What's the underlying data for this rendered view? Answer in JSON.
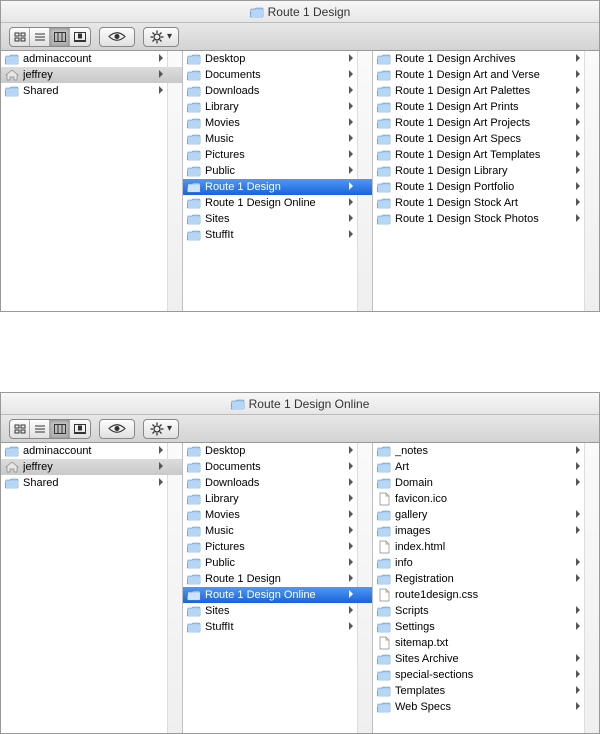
{
  "windows": [
    {
      "title": "Route 1 Design",
      "columns": [
        {
          "items": [
            {
              "label": "adminaccount",
              "icon": "folder",
              "arrow": true
            },
            {
              "label": "jeffrey",
              "icon": "home",
              "arrow": true,
              "state": "grey"
            },
            {
              "label": "Shared",
              "icon": "folder",
              "arrow": true
            }
          ]
        },
        {
          "items": [
            {
              "label": "Desktop",
              "icon": "folder",
              "arrow": true
            },
            {
              "label": "Documents",
              "icon": "folder",
              "arrow": true
            },
            {
              "label": "Downloads",
              "icon": "folder",
              "arrow": true
            },
            {
              "label": "Library",
              "icon": "folder",
              "arrow": true
            },
            {
              "label": "Movies",
              "icon": "folder",
              "arrow": true
            },
            {
              "label": "Music",
              "icon": "folder",
              "arrow": true
            },
            {
              "label": "Pictures",
              "icon": "folder",
              "arrow": true
            },
            {
              "label": "Public",
              "icon": "folder",
              "arrow": true
            },
            {
              "label": "Route 1 Design",
              "icon": "folder",
              "arrow": true,
              "state": "blue"
            },
            {
              "label": "Route 1 Design Online",
              "icon": "folder",
              "arrow": true
            },
            {
              "label": "Sites",
              "icon": "folder",
              "arrow": true
            },
            {
              "label": "StuffIt",
              "icon": "folder",
              "arrow": true
            }
          ]
        },
        {
          "items": [
            {
              "label": "Route 1 Design Archives",
              "icon": "folder",
              "arrow": true
            },
            {
              "label": "Route 1 Design Art and Verse",
              "icon": "folder",
              "arrow": true
            },
            {
              "label": "Route 1 Design Art Palettes",
              "icon": "folder",
              "arrow": true
            },
            {
              "label": "Route 1 Design Art Prints",
              "icon": "folder",
              "arrow": true
            },
            {
              "label": "Route 1 Design Art Projects",
              "icon": "folder",
              "arrow": true
            },
            {
              "label": "Route 1 Design Art Specs",
              "icon": "folder",
              "arrow": true
            },
            {
              "label": "Route 1 Design Art Templates",
              "icon": "folder",
              "arrow": true
            },
            {
              "label": "Route 1 Design Library",
              "icon": "folder",
              "arrow": true
            },
            {
              "label": "Route 1 Design Portfolio",
              "icon": "folder",
              "arrow": true
            },
            {
              "label": "Route 1 Design Stock Art",
              "icon": "folder",
              "arrow": true
            },
            {
              "label": "Route 1 Design Stock Photos",
              "icon": "folder",
              "arrow": true
            }
          ]
        }
      ]
    },
    {
      "title": "Route 1 Design Online",
      "columns": [
        {
          "items": [
            {
              "label": "adminaccount",
              "icon": "folder",
              "arrow": true
            },
            {
              "label": "jeffrey",
              "icon": "home",
              "arrow": true,
              "state": "grey"
            },
            {
              "label": "Shared",
              "icon": "folder",
              "arrow": true
            }
          ]
        },
        {
          "items": [
            {
              "label": "Desktop",
              "icon": "folder",
              "arrow": true
            },
            {
              "label": "Documents",
              "icon": "folder",
              "arrow": true
            },
            {
              "label": "Downloads",
              "icon": "folder",
              "arrow": true
            },
            {
              "label": "Library",
              "icon": "folder",
              "arrow": true
            },
            {
              "label": "Movies",
              "icon": "folder",
              "arrow": true
            },
            {
              "label": "Music",
              "icon": "folder",
              "arrow": true
            },
            {
              "label": "Pictures",
              "icon": "folder",
              "arrow": true
            },
            {
              "label": "Public",
              "icon": "folder",
              "arrow": true
            },
            {
              "label": "Route 1 Design",
              "icon": "folder",
              "arrow": true
            },
            {
              "label": "Route 1 Design Online",
              "icon": "folder",
              "arrow": true,
              "state": "blue"
            },
            {
              "label": "Sites",
              "icon": "folder",
              "arrow": true
            },
            {
              "label": "StuffIt",
              "icon": "folder",
              "arrow": true
            }
          ]
        },
        {
          "items": [
            {
              "label": "_notes",
              "icon": "folder",
              "arrow": true
            },
            {
              "label": "Art",
              "icon": "folder",
              "arrow": true
            },
            {
              "label": "Domain",
              "icon": "folder",
              "arrow": true
            },
            {
              "label": "favicon.ico",
              "icon": "file",
              "arrow": false
            },
            {
              "label": "gallery",
              "icon": "folder",
              "arrow": true
            },
            {
              "label": "images",
              "icon": "folder",
              "arrow": true
            },
            {
              "label": "index.html",
              "icon": "file",
              "arrow": false
            },
            {
              "label": "info",
              "icon": "folder",
              "arrow": true
            },
            {
              "label": "Registration",
              "icon": "folder",
              "arrow": true
            },
            {
              "label": "route1design.css",
              "icon": "file",
              "arrow": false
            },
            {
              "label": "Scripts",
              "icon": "folder",
              "arrow": true
            },
            {
              "label": "Settings",
              "icon": "folder",
              "arrow": true
            },
            {
              "label": "sitemap.txt",
              "icon": "file",
              "arrow": false
            },
            {
              "label": "Sites Archive",
              "icon": "folder",
              "arrow": true
            },
            {
              "label": "special-sections",
              "icon": "folder",
              "arrow": true
            },
            {
              "label": "Templates",
              "icon": "folder",
              "arrow": true
            },
            {
              "label": "Web Specs",
              "icon": "folder",
              "arrow": true
            }
          ]
        }
      ]
    }
  ]
}
